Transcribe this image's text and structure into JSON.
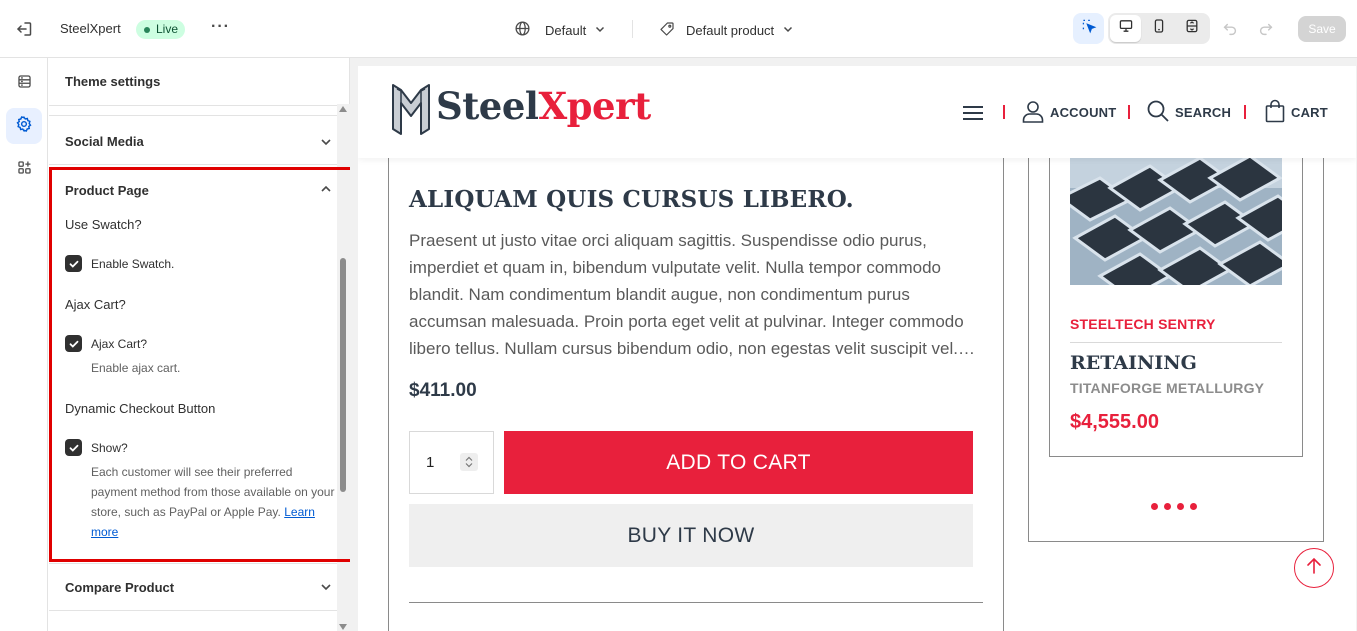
{
  "topbar": {
    "store_name": "SteelXpert",
    "status_badge": "Live",
    "more": "···",
    "theme_selector": "Default",
    "template_selector": "Default product",
    "save_label": "Save"
  },
  "rail": {
    "items": [
      {
        "icon": "sections-icon"
      },
      {
        "icon": "gear-icon",
        "active": true
      },
      {
        "icon": "apps-icon"
      }
    ]
  },
  "panel": {
    "header": "Theme settings",
    "social_media": "Social Media",
    "product_page": {
      "title": "Product Page",
      "use_swatch_heading": "Use Swatch?",
      "enable_swatch_label": "Enable Swatch.",
      "ajax_cart_heading": "Ajax Cart?",
      "ajax_cart_label": "Ajax Cart?",
      "ajax_cart_help": "Enable ajax cart.",
      "dynamic_checkout_heading": "Dynamic Checkout Button",
      "show_label": "Show?",
      "show_help": "Each customer will see their preferred payment method from those available on your store, such as PayPal or Apple Pay.",
      "learn_more": "Learn more"
    },
    "compare_product": "Compare Product"
  },
  "preview": {
    "logo": {
      "part1": "Steel",
      "part2": "Xpert"
    },
    "nav": {
      "account": "ACCOUNT",
      "search": "SEARCH",
      "cart": "CART"
    },
    "product": {
      "title": "ALIQUAM QUIS CURSUS LIBERO.",
      "description": "Praesent ut justo vitae orci aliquam sagittis. Suspendisse odio purus, imperdiet et quam in, bibendum vulputate velit. Nulla tempor commodo blandit. Nam condimentum blandit augue, non condimentum purus accumsan malesuada. Proin porta eget velit at pulvinar. Integer commodo libero tellus. Nullam cursus bibendum odio, non egestas velit suscipit vel.…",
      "price": "$411.00",
      "quantity": "1",
      "add_to_cart": "ADD TO CART",
      "buy_now": "BUY IT NOW"
    },
    "side_product": {
      "vendor": "STEELTECH SENTRY",
      "title": "RETAINING",
      "subtitle": "TITANFORGE METALLURGY",
      "price": "$4,555.00"
    }
  },
  "colors": {
    "brand_red": "#e8203c",
    "brand_navy": "#2e3a48",
    "highlight": "#e00000",
    "live_badge_bg": "#cdfee1"
  }
}
